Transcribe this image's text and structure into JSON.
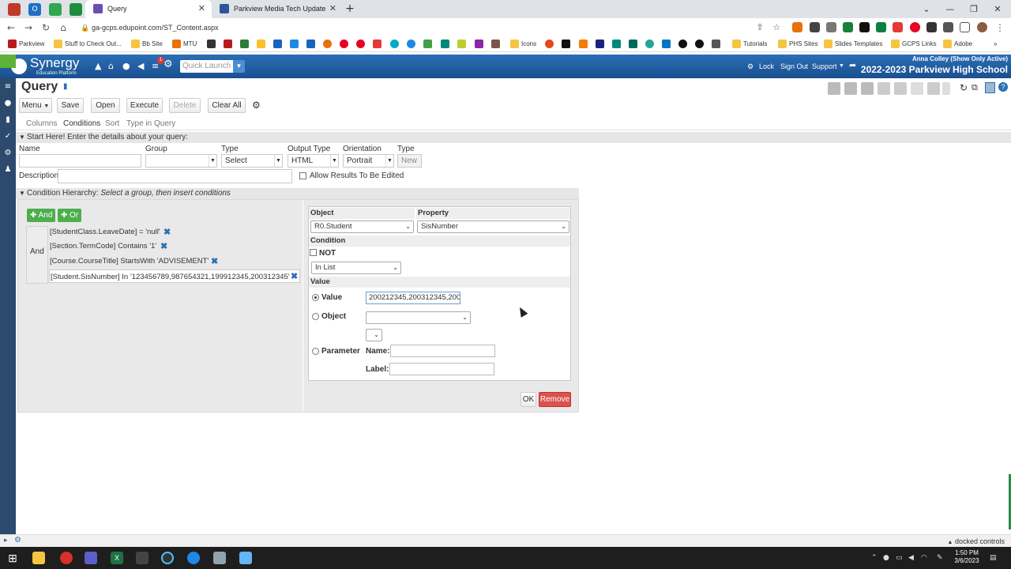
{
  "browser": {
    "tabs": [
      {
        "title": "Query",
        "active": true
      },
      {
        "title": "Parkview Media Tech Update",
        "active": false
      }
    ],
    "new_tab": "+",
    "url": "ga-gcps.edupoint.com/ST_Content.aspx",
    "bookmarks": [
      "Parkview",
      "Stuff to Check Out...",
      "Bb Site",
      "MTU",
      "Icons",
      "Tutorials",
      "PHS Sites",
      "Slides Templates",
      "GCPS Links",
      "Adobe"
    ]
  },
  "synergy": {
    "logo_text": "Synergy",
    "logo_sub": "Education Platform",
    "quick_launch_placeholder": "Quick Launch",
    "notif_count": "1",
    "lock": "Lock",
    "sign_out": "Sign Out",
    "support": "Support",
    "user": "Anna Colley (Show Only Active)",
    "school": "2022-2023 Parkview High School"
  },
  "page": {
    "title": "Query",
    "toolbar": {
      "menu": "Menu",
      "save": "Save",
      "open": "Open",
      "execute": "Execute",
      "delete": "Delete",
      "clear_all": "Clear All"
    },
    "subtabs": [
      "Columns",
      "Conditions",
      "Sort",
      "Type in Query"
    ],
    "start_section": "Start Here! Enter the details about your query:",
    "fields": {
      "name_label": "Name",
      "name_value": "",
      "group_label": "Group",
      "group_value": "",
      "type_label": "Type",
      "type_value": "Select",
      "output_label": "Output Type",
      "output_value": "HTML",
      "orientation_label": "Orientation",
      "orientation_value": "Portrait",
      "type2_label": "Type",
      "type2_value": "New",
      "description_label": "Description",
      "description_value": "",
      "allow_edit": "Allow Results To Be Edited"
    },
    "condition_section": "Condition Hierarchy:",
    "condition_hint": "Select a group, then insert conditions",
    "and_btn": "And",
    "or_btn": "Or",
    "group_label": "And",
    "conditions": [
      "[StudentClass.LeaveDate] = 'null'",
      "[Section.TermCode] Contains '1'",
      "[Course.CourseTitle] StartsWith 'ADVISEMENT'",
      "[Student.SisNumber] In '123456789,987654321,199912345,200312345'"
    ],
    "editor": {
      "object_hdr": "Object",
      "property_hdr": "Property",
      "object_value": "R0.Student",
      "property_value": "SisNumber",
      "condition_hdr": "Condition",
      "not_label": "NOT",
      "operator": "In List",
      "value_hdr": "Value",
      "value_radio": "Value",
      "value_text": "200212345,200312345,200",
      "object_radio": "Object",
      "parameter_radio": "Parameter",
      "name_label": "Name:",
      "label_label": "Label:"
    },
    "ok": "OK",
    "remove": "Remove"
  },
  "status": {
    "docked": "docked controls"
  },
  "taskbar": {
    "time": "1:50 PM",
    "date": "3/6/2023"
  },
  "colors": {
    "header_blue": "#1f5fa3",
    "green": "#4cae4c",
    "remove_red": "#d9534f"
  }
}
